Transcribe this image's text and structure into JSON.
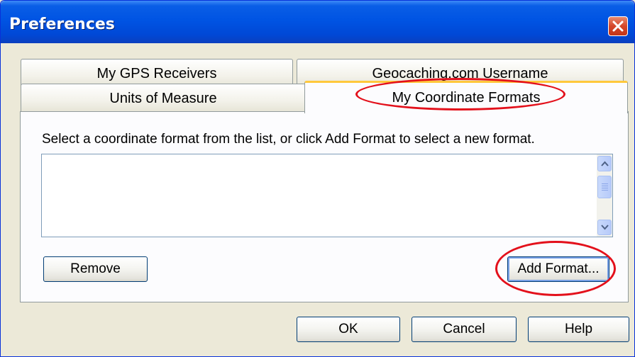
{
  "window": {
    "title": "Preferences",
    "title_color": "#ffffff",
    "titlebar_color": "#0054e3"
  },
  "tabs": [
    {
      "label": "My GPS Receivers",
      "selected": false
    },
    {
      "label": "Geocaching.com Username",
      "selected": false
    },
    {
      "label": "Units of Measure",
      "selected": false
    },
    {
      "label": "My Coordinate Formats",
      "selected": true
    }
  ],
  "panel": {
    "instruction": "Select a coordinate format from the list, or click Add Format to select a new format.",
    "list_items": [],
    "remove_label": "Remove",
    "add_format_label": "Add Format..."
  },
  "footer": {
    "ok_label": "OK",
    "cancel_label": "Cancel",
    "help_label": "Help"
  },
  "annotations": {
    "color": "#e3101b",
    "highlighted": [
      "My Coordinate Formats",
      "Add Format..."
    ]
  },
  "icons": [
    "close-icon",
    "scroll-up-icon",
    "scroll-down-icon"
  ]
}
